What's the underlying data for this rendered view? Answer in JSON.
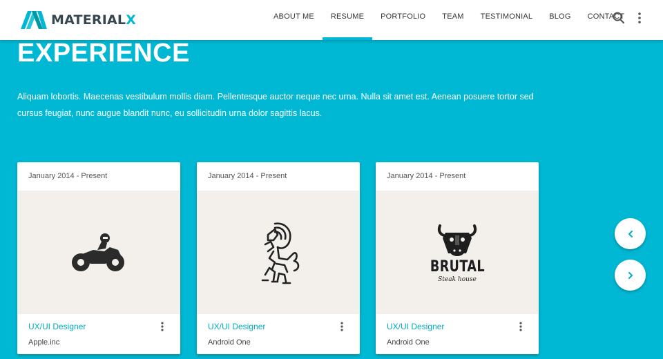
{
  "nav": {
    "logo_text": "MATERIAL",
    "logo_accent": "X",
    "items": [
      {
        "label": "ABOUT ME"
      },
      {
        "label": "RESUME",
        "active": true
      },
      {
        "label": "PORTFOLIO"
      },
      {
        "label": "TEAM"
      },
      {
        "label": "TESTIMONIAL"
      },
      {
        "label": "BLOG"
      },
      {
        "label": "CONTACT"
      }
    ],
    "icons": [
      "search-icon",
      "more-vert-icon"
    ]
  },
  "section": {
    "title": "EXPERIENCE",
    "description": "Aliquam lobortis. Maecenas vestibulum mollis diam. Pellentesque auctor neque nec urna. Nulla sit amet est. Aenean posuere tortor sed cursus feugiat, nunc augue blandit nunc, eu sollicitudin urna dolor sagittis lacus."
  },
  "cards": [
    {
      "date": "January 2014 - Present",
      "role": "UX/UI Designer",
      "company": "Apple.inc",
      "image_icon": "motorcycle-logo-icon"
    },
    {
      "date": "January 2014 - Present",
      "role": "UX/UI Designer",
      "company": "Android One",
      "image_icon": "lion-logo-icon"
    },
    {
      "date": "January 2014 - Present",
      "role": "UX/UI Designer",
      "company": "Android One",
      "image_icon": "brutal-steakhouse-logo-icon",
      "logo_text": "BRUTAL",
      "logo_subtext": "Steak house"
    }
  ],
  "slider": {
    "prev_icon": "chevron-left-icon",
    "next_icon": "chevron-right-icon"
  },
  "colors": {
    "accent": "#00b8d4",
    "text_dark": "#37474f",
    "card_media_bg": "#f3f0eb"
  }
}
